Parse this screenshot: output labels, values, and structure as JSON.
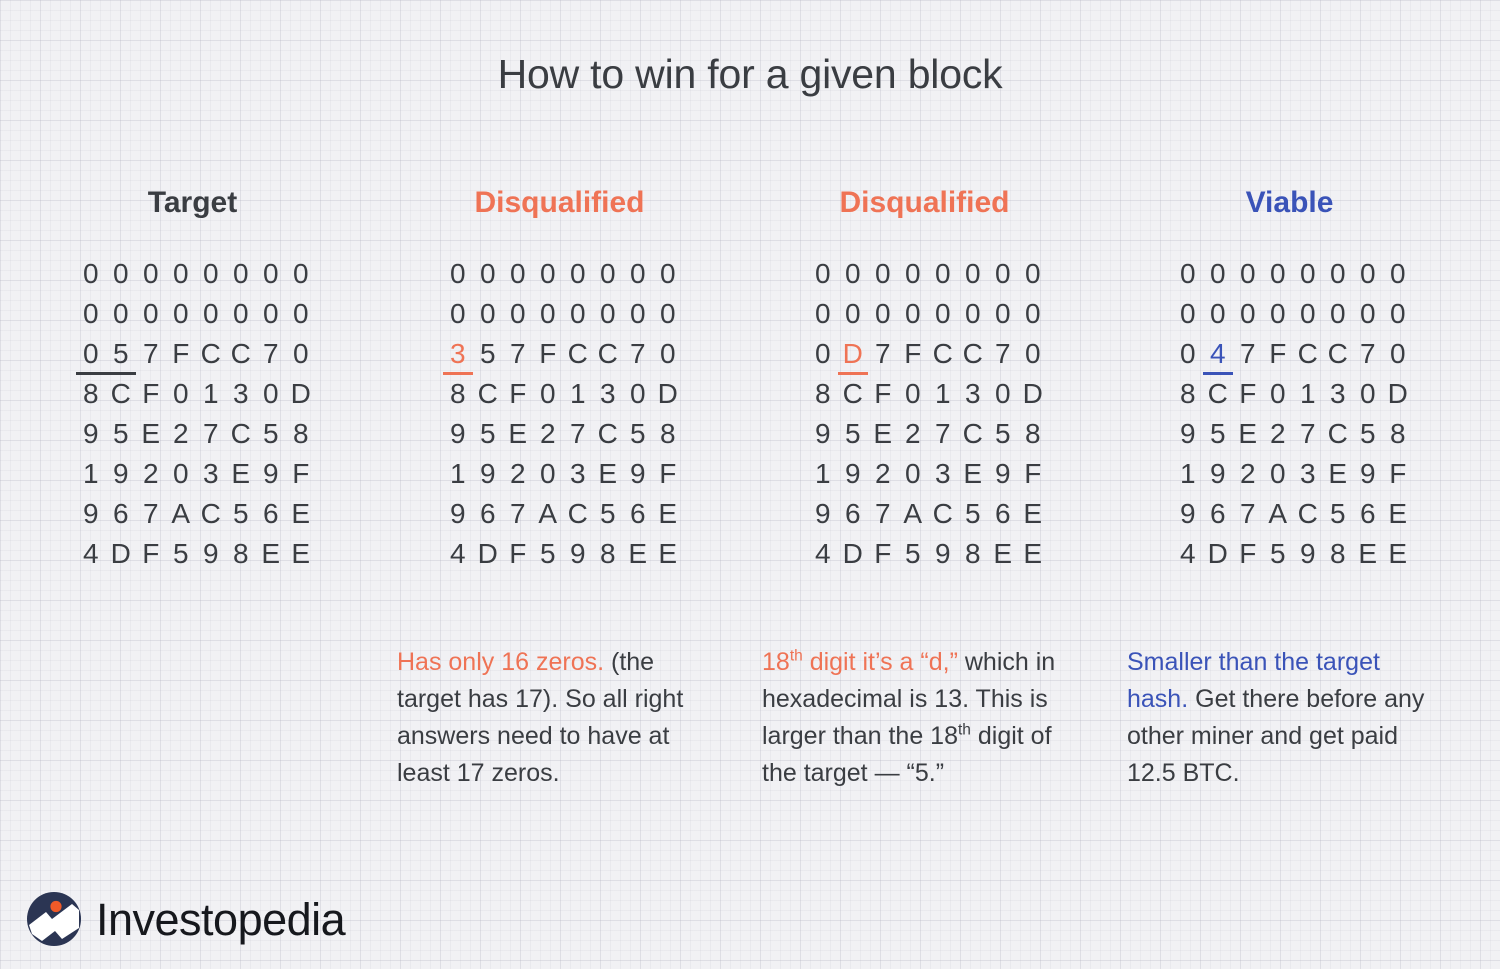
{
  "page": {
    "title": "How to win for a given block",
    "background": "#f1f1f4",
    "text_color": "#3a3d42",
    "accent_orange": "#ef7355",
    "accent_blue": "#3a53b8"
  },
  "columns": [
    {
      "header": "Target",
      "header_color": "#3a3d42",
      "hash_rows": [
        "00000000",
        "00000000",
        "057FCC70",
        "8CF0130D",
        "95E27C58",
        "19203E9F",
        "967AC56E",
        "4DF598EE"
      ],
      "highlight": {
        "row": 2,
        "start": 0,
        "end": 1,
        "style": "underline",
        "color": "#3a3d42"
      },
      "caption_lead": "",
      "caption_lead_color": "",
      "caption_body": ""
    },
    {
      "header": "Disqualified",
      "header_color": "#ef7355",
      "hash_rows": [
        "00000000",
        "00000000",
        "357FCC70",
        "8CF0130D",
        "95E27C58",
        "19203E9F",
        "967AC56E",
        "4DF598EE"
      ],
      "highlight": {
        "row": 2,
        "start": 0,
        "end": 0,
        "style": "orange",
        "color": "#ef7355"
      },
      "caption_lead": "Has only 16 zeros.",
      "caption_lead_color": "#ef7355",
      "caption_body": "(the target has 17). So all right answers need to have at least 17 zeros."
    },
    {
      "header": "Disqualified",
      "header_color": "#ef7355",
      "hash_rows": [
        "00000000",
        "00000000",
        "0D7FCC70",
        "8CF0130D",
        "95E27C58",
        "19203E9F",
        "967AC56E",
        "4DF598EE"
      ],
      "highlight": {
        "row": 2,
        "start": 1,
        "end": 1,
        "style": "orange",
        "color": "#ef7355"
      },
      "caption_lead_pre": "18",
      "caption_lead_sup": "th",
      "caption_lead_post": " digit it’s a “d,”",
      "caption_lead_color": "#ef7355",
      "caption_body_1": "which in hexadecimal is 13. This is larger than the 18",
      "caption_body_sup": "th",
      "caption_body_2": " digit of the target — “5.”"
    },
    {
      "header": "Viable",
      "header_color": "#3a53b8",
      "hash_rows": [
        "00000000",
        "00000000",
        "047FCC70",
        "8CF0130D",
        "95E27C58",
        "19203E9F",
        "967AC56E",
        "4DF598EE"
      ],
      "highlight": {
        "row": 2,
        "start": 1,
        "end": 1,
        "style": "blue",
        "color": "#3a53b8"
      },
      "caption_lead": "Smaller than the target hash.",
      "caption_lead_color": "#3a53b8",
      "caption_body": "Get there before any other miner and get paid 12.5 BTC."
    }
  ],
  "logo": {
    "wordmark": "Investopedia",
    "mark_circle_color": "#2b3553",
    "mark_dot_color": "#f05a28",
    "mark_swoosh_color": "#ffffff"
  }
}
